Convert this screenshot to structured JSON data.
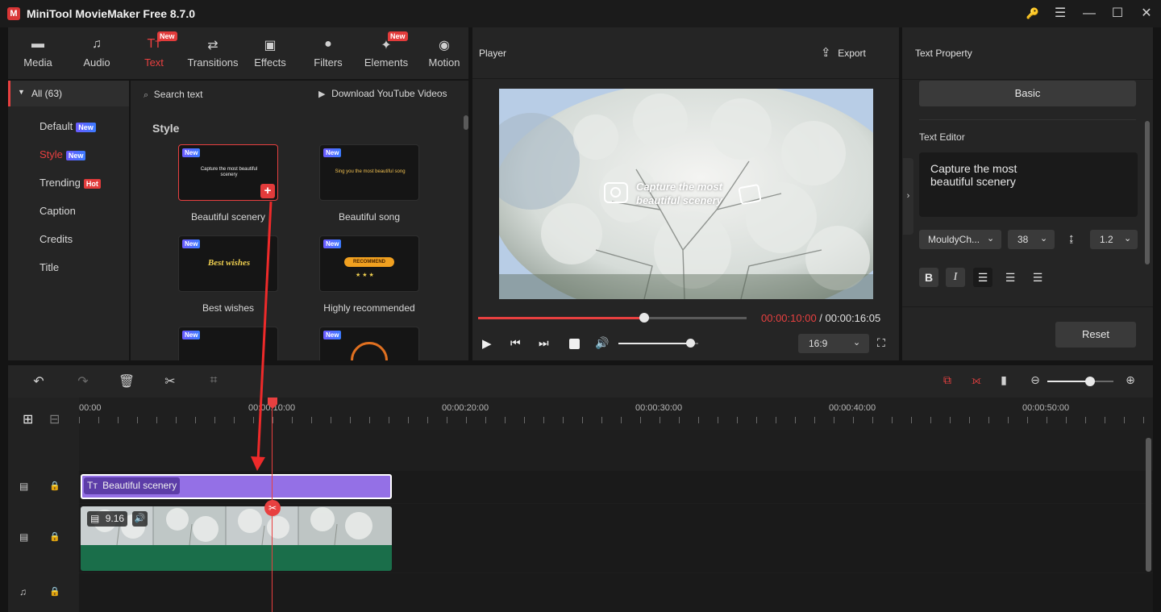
{
  "window": {
    "title": "MiniTool MovieMaker Free 8.7.0",
    "logo": "M",
    "controls": {
      "key": "🔑",
      "menu": "☰",
      "minimize": "—",
      "maximize": "☐",
      "close": "✕"
    }
  },
  "categories": [
    {
      "label": "Media",
      "icon": "▬",
      "new": ""
    },
    {
      "label": "Audio",
      "icon": "♫",
      "new": ""
    },
    {
      "label": "Text",
      "icon": "Tт",
      "new": "New"
    },
    {
      "label": "Transitions",
      "icon": "⇄",
      "new": ""
    },
    {
      "label": "Effects",
      "icon": "▣",
      "new": ""
    },
    {
      "label": "Filters",
      "icon": "●",
      "new": ""
    },
    {
      "label": "Elements",
      "icon": "✦",
      "new": "New"
    },
    {
      "label": "Motion",
      "icon": "◉",
      "new": ""
    }
  ],
  "sidebar": {
    "all": "All (63)",
    "items": [
      {
        "label": "Default",
        "tag": "New"
      },
      {
        "label": "Style",
        "tag": "New"
      },
      {
        "label": "Trending",
        "tag": "Hot"
      },
      {
        "label": "Caption",
        "tag": ""
      },
      {
        "label": "Credits",
        "tag": ""
      },
      {
        "label": "Title",
        "tag": ""
      }
    ]
  },
  "library": {
    "search": "Search text",
    "download": "Download YouTube Videos",
    "section": "Style",
    "tiles": [
      {
        "label": "Beautiful scenery",
        "preview": "Capture the most beautiful scenery",
        "badge": "New"
      },
      {
        "label": "Beautiful song",
        "preview": "Sing you the most beautiful song",
        "badge": "New"
      },
      {
        "label": "Best wishes",
        "preview": "Best wishes",
        "badge": "New"
      },
      {
        "label": "Highly recommended",
        "preview": "RECOMMEND",
        "badge": "New"
      },
      {
        "label": "",
        "preview": "",
        "badge": "New"
      },
      {
        "label": "",
        "preview": "",
        "badge": "New"
      }
    ],
    "add_icon": "+"
  },
  "player": {
    "title": "Player",
    "export": "Export",
    "overlay_line1": "Capture the most",
    "overlay_line2": "beautiful scenery",
    "current_time": "00:00:10:00",
    "separator": " / ",
    "total_time": "00:00:16:05",
    "progress": 0.62,
    "volume": 0.9,
    "aspect": "16:9"
  },
  "property": {
    "title": "Text Property",
    "tab": "Basic",
    "editor_label": "Text Editor",
    "text": "Capture the most\nbeautiful scenery",
    "font": "MouldyCh...",
    "size": "38",
    "line_spacing": "1.2",
    "format": [
      "B",
      "I"
    ],
    "reset": "Reset"
  },
  "timeline": {
    "ticks": [
      "00:00",
      "00:00:10:00",
      "00:00:20:00",
      "00:00:30:00",
      "00:00:40:00",
      "00:00:50:00"
    ],
    "text_clip": "Beautiful scenery",
    "video_clip_duration": "9.16",
    "zoom": 0.65
  },
  "colors": {
    "accent": "#e84040",
    "text_clip": "#9470e6",
    "audio_strip": "#1a6e4a"
  }
}
